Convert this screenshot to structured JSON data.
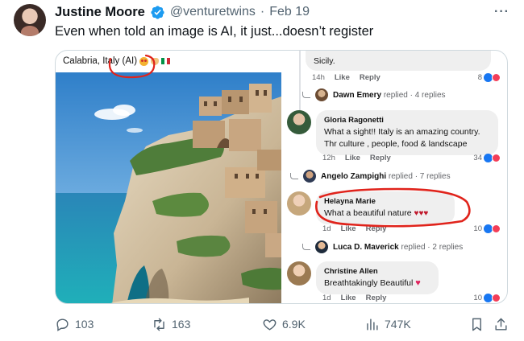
{
  "tweet": {
    "author": "Justine Moore",
    "handle": "@venturetwins",
    "separator": "·",
    "date": "Feb 19",
    "more_icon": "more-horizontal-icon",
    "text": "Even when told an image is AI, it just...doesn’t register"
  },
  "embedded": {
    "post": {
      "caption": "Calabria, Italy (AI)"
    },
    "comments": [
      {
        "name": "",
        "text": "Sicily.",
        "time": "14h",
        "like": "Like",
        "reply": "Reply",
        "reactions": "8"
      },
      {
        "name": "Gloria Ragonetti",
        "text_lines": [
          "What a sight!! Italy is an amazing country.",
          "Thr culture , people, food & landscape"
        ],
        "time": "12h",
        "like": "Like",
        "reply": "Reply",
        "reactions": "34"
      },
      {
        "name": "Helayna Marie",
        "text": "What a beautiful nature",
        "time": "1d",
        "like": "Like",
        "reply": "Reply",
        "reactions": "10"
      },
      {
        "name": "Christine Allen",
        "text": "Breathtakingly Beautiful",
        "time": "1d",
        "like": "Like",
        "reply": "Reply",
        "reactions": "10"
      }
    ],
    "replies": [
      {
        "name": "Dawn Emery",
        "suffix": "replied · 4 replies"
      },
      {
        "name": "Angelo Zampighi",
        "suffix": "replied · 7 replies"
      },
      {
        "name": "Luca D. Maverick",
        "suffix": "replied · 2 replies"
      }
    ]
  },
  "actions": {
    "replies": "103",
    "reposts": "163",
    "likes": "6.9K",
    "views": "747K"
  },
  "colors": {
    "verified": "#1d9bf0",
    "annotation": "#e0231b",
    "muted": "#536471",
    "facebook_like": "#1877f2",
    "facebook_love": "#f33e58"
  }
}
